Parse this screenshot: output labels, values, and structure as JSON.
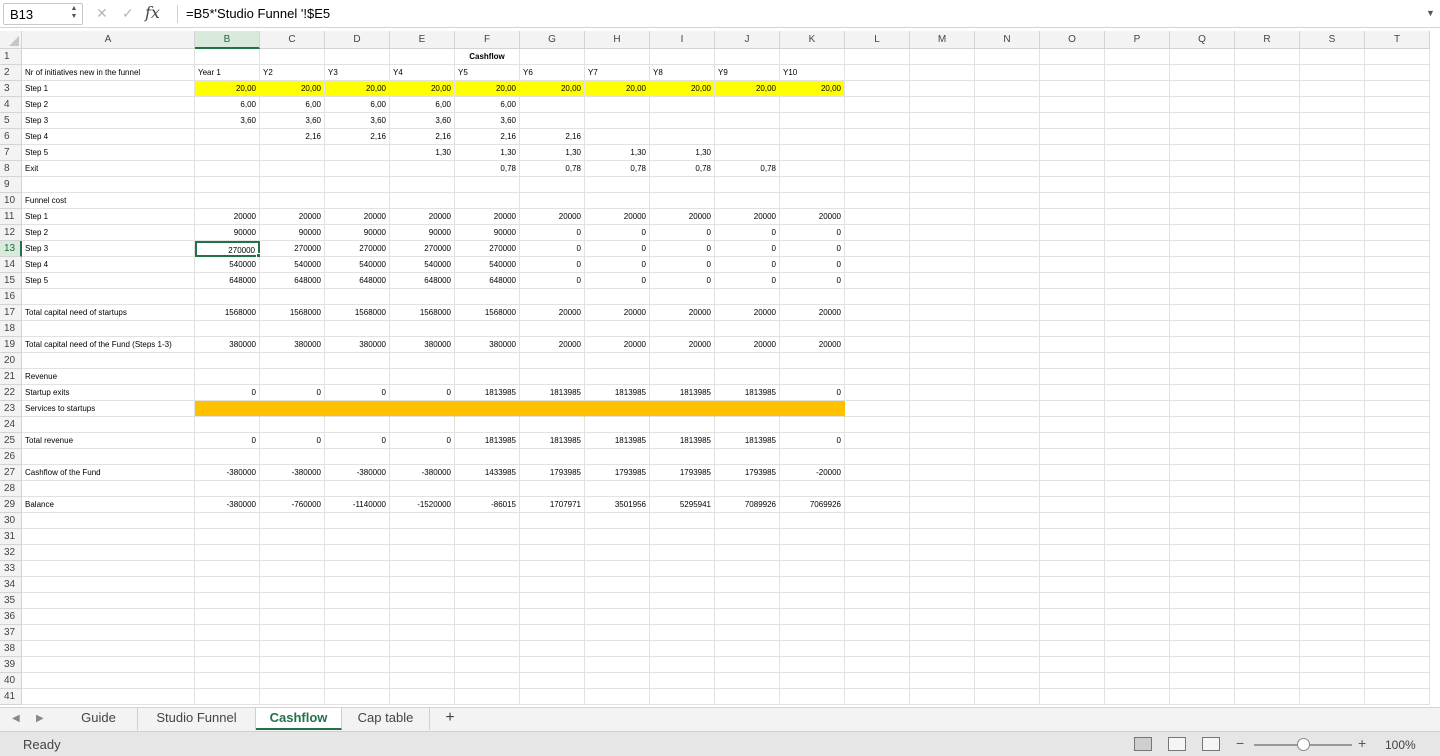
{
  "formula_bar": {
    "name_box": "B13",
    "formula": "=B5*'Studio Funnel '!$E5"
  },
  "columns": [
    "A",
    "B",
    "C",
    "D",
    "E",
    "F",
    "G",
    "H",
    "I",
    "J",
    "K",
    "L",
    "M",
    "N",
    "O",
    "P",
    "Q",
    "R",
    "S",
    "T"
  ],
  "selected_cell": {
    "column": "B",
    "row": 13
  },
  "colors": {
    "accent": "#217346",
    "highlight_yellow": "#ffff00",
    "highlight_orange": "#ffc000"
  },
  "rows": [
    {
      "n": "1",
      "cells": {
        "F": "Cashflow"
      }
    },
    {
      "n": "2",
      "cells": {
        "A": "Nr of initiatives new in the funnel",
        "B": "Year 1",
        "C": "Y2",
        "D": "Y3",
        "E": "Y4",
        "F": "Y5",
        "G": "Y6",
        "H": "Y7",
        "I": "Y8",
        "J": "Y9",
        "K": "Y10"
      }
    },
    {
      "n": "3",
      "cells": {
        "A": "Step 1",
        "B": "20,00",
        "C": "20,00",
        "D": "20,00",
        "E": "20,00",
        "F": "20,00",
        "G": "20,00",
        "H": "20,00",
        "I": "20,00",
        "J": "20,00",
        "K": "20,00"
      }
    },
    {
      "n": "4",
      "cells": {
        "A": "Step 2",
        "B": "6,00",
        "C": "6,00",
        "D": "6,00",
        "E": "6,00",
        "F": "6,00"
      }
    },
    {
      "n": "5",
      "cells": {
        "A": "Step 3",
        "B": "3,60",
        "C": "3,60",
        "D": "3,60",
        "E": "3,60",
        "F": "3,60"
      }
    },
    {
      "n": "6",
      "cells": {
        "A": "Step 4",
        "C": "2,16",
        "D": "2,16",
        "E": "2,16",
        "F": "2,16",
        "G": "2,16"
      }
    },
    {
      "n": "7",
      "cells": {
        "A": "Step 5",
        "E": "1,30",
        "F": "1,30",
        "G": "1,30",
        "H": "1,30",
        "I": "1,30"
      }
    },
    {
      "n": "8",
      "cells": {
        "A": "Exit",
        "F": "0,78",
        "G": "0,78",
        "H": "0,78",
        "I": "0,78",
        "J": "0,78"
      }
    },
    {
      "n": "9",
      "cells": {}
    },
    {
      "n": "10",
      "cells": {
        "A": "Funnel cost"
      }
    },
    {
      "n": "11",
      "cells": {
        "A": "Step 1",
        "B": "20000",
        "C": "20000",
        "D": "20000",
        "E": "20000",
        "F": "20000",
        "G": "20000",
        "H": "20000",
        "I": "20000",
        "J": "20000",
        "K": "20000"
      }
    },
    {
      "n": "12",
      "cells": {
        "A": "Step 2",
        "B": "90000",
        "C": "90000",
        "D": "90000",
        "E": "90000",
        "F": "90000",
        "G": "0",
        "H": "0",
        "I": "0",
        "J": "0",
        "K": "0"
      }
    },
    {
      "n": "13",
      "cells": {
        "A": "Step 3",
        "B": "270000",
        "C": "270000",
        "D": "270000",
        "E": "270000",
        "F": "270000",
        "G": "0",
        "H": "0",
        "I": "0",
        "J": "0",
        "K": "0"
      }
    },
    {
      "n": "14",
      "cells": {
        "A": "Step 4",
        "B": "540000",
        "C": "540000",
        "D": "540000",
        "E": "540000",
        "F": "540000",
        "G": "0",
        "H": "0",
        "I": "0",
        "J": "0",
        "K": "0"
      }
    },
    {
      "n": "15",
      "cells": {
        "A": "Step 5",
        "B": "648000",
        "C": "648000",
        "D": "648000",
        "E": "648000",
        "F": "648000",
        "G": "0",
        "H": "0",
        "I": "0",
        "J": "0",
        "K": "0"
      }
    },
    {
      "n": "16",
      "cells": {}
    },
    {
      "n": "17",
      "cells": {
        "A": "Total capital need of startups",
        "B": "1568000",
        "C": "1568000",
        "D": "1568000",
        "E": "1568000",
        "F": "1568000",
        "G": "20000",
        "H": "20000",
        "I": "20000",
        "J": "20000",
        "K": "20000"
      }
    },
    {
      "n": "18",
      "cells": {}
    },
    {
      "n": "19",
      "cells": {
        "A": "Total capital need of the Fund (Steps 1-3)",
        "B": "380000",
        "C": "380000",
        "D": "380000",
        "E": "380000",
        "F": "380000",
        "G": "20000",
        "H": "20000",
        "I": "20000",
        "J": "20000",
        "K": "20000"
      }
    },
    {
      "n": "20",
      "cells": {}
    },
    {
      "n": "21",
      "cells": {
        "A": "Revenue"
      }
    },
    {
      "n": "22",
      "cells": {
        "A": "Startup exits",
        "B": "0",
        "C": "0",
        "D": "0",
        "E": "0",
        "F": "1813985",
        "G": "1813985",
        "H": "1813985",
        "I": "1813985",
        "J": "1813985",
        "K": "0"
      }
    },
    {
      "n": "23",
      "cells": {
        "A": "Services to startups"
      }
    },
    {
      "n": "24",
      "cells": {}
    },
    {
      "n": "25",
      "cells": {
        "A": "Total revenue",
        "B": "0",
        "C": "0",
        "D": "0",
        "E": "0",
        "F": "1813985",
        "G": "1813985",
        "H": "1813985",
        "I": "1813985",
        "J": "1813985",
        "K": "0"
      }
    },
    {
      "n": "26",
      "cells": {}
    },
    {
      "n": "27",
      "cells": {
        "A": "Cashflow of the Fund",
        "B": "-380000",
        "C": "-380000",
        "D": "-380000",
        "E": "-380000",
        "F": "1433985",
        "G": "1793985",
        "H": "1793985",
        "I": "1793985",
        "J": "1793985",
        "K": "-20000"
      }
    },
    {
      "n": "28",
      "cells": {}
    },
    {
      "n": "29",
      "cells": {
        "A": "Balance",
        "B": "-380000",
        "C": "-760000",
        "D": "-1140000",
        "E": "-1520000",
        "F": "-86015",
        "G": "1707971",
        "H": "3501956",
        "I": "5295941",
        "J": "7089926",
        "K": "7069926"
      }
    },
    {
      "n": "30",
      "cells": {}
    },
    {
      "n": "31",
      "cells": {}
    },
    {
      "n": "32",
      "cells": {}
    },
    {
      "n": "33",
      "cells": {}
    },
    {
      "n": "34",
      "cells": {}
    },
    {
      "n": "35",
      "cells": {}
    },
    {
      "n": "36",
      "cells": {}
    },
    {
      "n": "37",
      "cells": {}
    },
    {
      "n": "38",
      "cells": {}
    },
    {
      "n": "39",
      "cells": {}
    },
    {
      "n": "40",
      "cells": {}
    },
    {
      "n": "41",
      "cells": {}
    }
  ],
  "tabs": [
    {
      "label": "Guide",
      "active": false
    },
    {
      "label": "Studio Funnel",
      "active": false
    },
    {
      "label": "Cashflow",
      "active": true
    },
    {
      "label": "Cap table",
      "active": false
    }
  ],
  "add_sheet_label": "+",
  "status": {
    "text": "Ready",
    "zoom": "100%",
    "zoom_minus": "−",
    "zoom_plus": "+"
  }
}
